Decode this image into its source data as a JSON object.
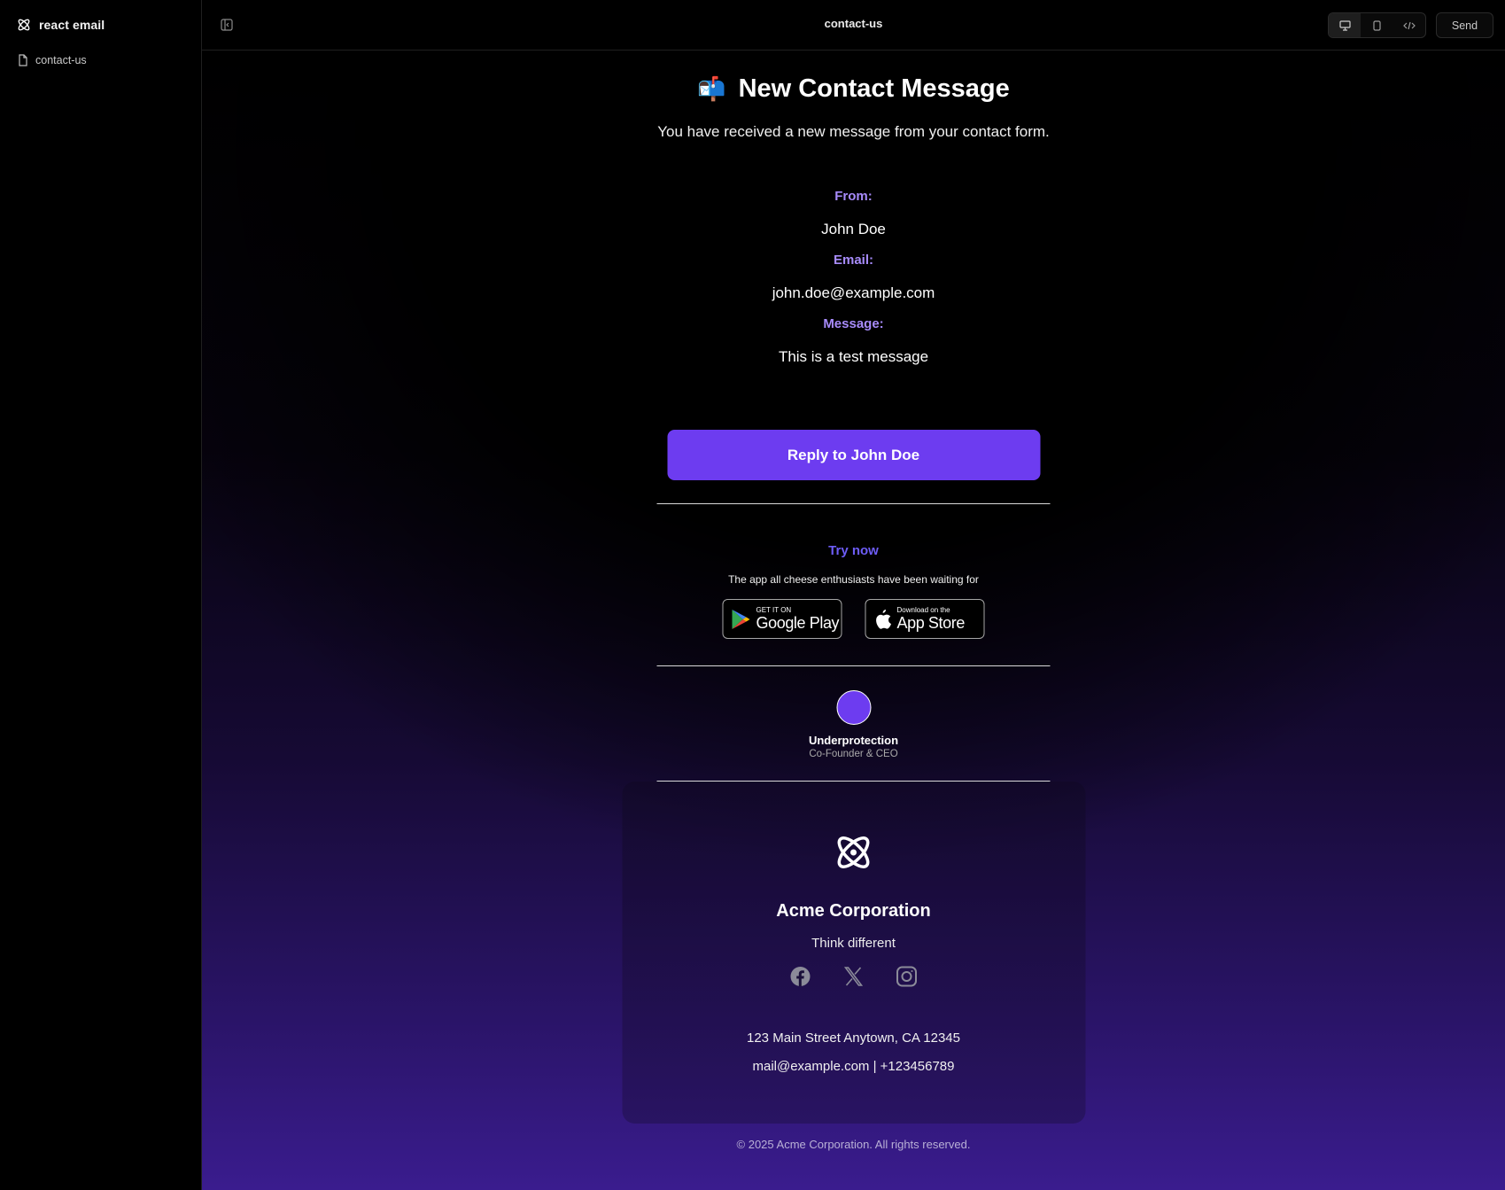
{
  "app": {
    "brand": "react email"
  },
  "sidebar": {
    "items": [
      {
        "label": "contact-us"
      }
    ]
  },
  "topbar": {
    "title": "contact-us",
    "send_label": "Send"
  },
  "email": {
    "headline_emoji": "📬",
    "headline": "New Contact Message",
    "intro": "You have received a new message from your contact form.",
    "fields": [
      {
        "label": "From:",
        "value": "John Doe"
      },
      {
        "label": "Email:",
        "value": "john.doe@example.com"
      },
      {
        "label": "Message:",
        "value": "This is a test message"
      }
    ],
    "reply_button": "Reply to John Doe",
    "promo": {
      "title": "Try now",
      "tagline": "The app all cheese enthusiasts have been waiting for",
      "google": {
        "small": "GET IT ON",
        "big": "Google Play"
      },
      "apple": {
        "small": "Download on the",
        "big": "App Store"
      }
    },
    "signature": {
      "name": "Underprotection",
      "role": "Co-Founder & CEO"
    },
    "footer": {
      "company": "Acme Corporation",
      "slogan": "Think different",
      "address": "123 Main Street Anytown, CA 12345",
      "contact": "mail@example.com | +123456789",
      "copyright": "© 2025 Acme Corporation. All rights reserved."
    }
  },
  "colors": {
    "accent": "#6d3cf0",
    "label": "#a78bfa",
    "link": "#6d5cf6"
  }
}
